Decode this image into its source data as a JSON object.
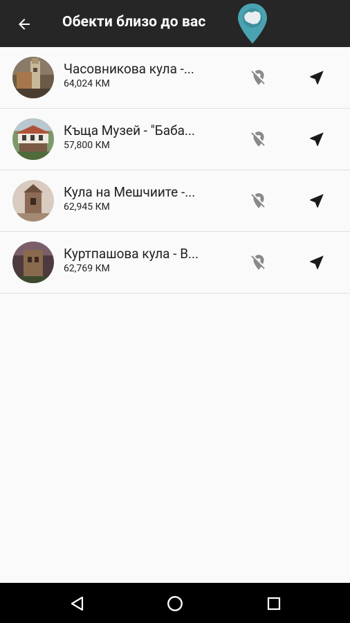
{
  "appbar": {
    "title": "Обекти близо до вас",
    "back_icon": "arrow-back-icon",
    "logo_icon": "map-pin-logo-icon",
    "background": "#262626",
    "logo_color": "#4aa3b0"
  },
  "items": [
    {
      "title": "Часовникова кула -...",
      "distance": "64,024 КМ",
      "image": "clock-tower-photo"
    },
    {
      "title": "Къща Музей - \"Баба...",
      "distance": "57,800 КМ",
      "image": "house-museum-photo"
    },
    {
      "title": "Кула на Мешчиите -...",
      "distance": "62,945 КМ",
      "image": "meshchii-tower-photo"
    },
    {
      "title": "Куртпашова кула - В...",
      "distance": "62,769 КМ",
      "image": "kurtpasha-tower-photo"
    }
  ],
  "row_actions": {
    "location_off_icon": "location-off-icon",
    "navigate_icon": "navigation-arrow-icon"
  },
  "system_nav": {
    "back_icon": "triangle-back-icon",
    "home_icon": "circle-home-icon",
    "recents_icon": "square-recents-icon"
  }
}
